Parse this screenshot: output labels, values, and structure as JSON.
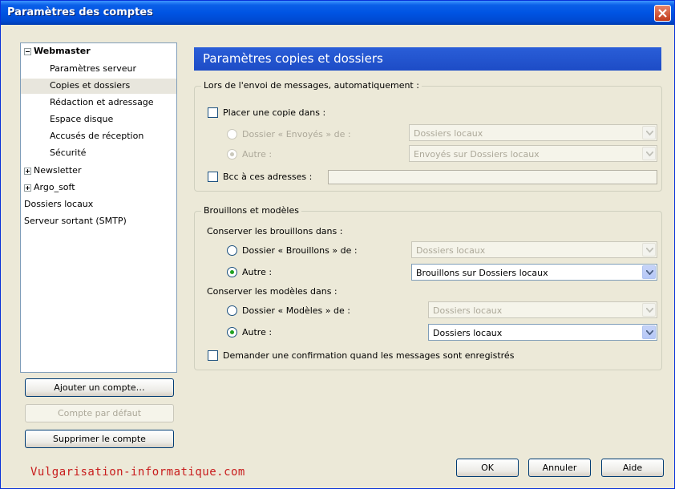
{
  "window": {
    "title": "Paramètres des comptes"
  },
  "tree": {
    "items": [
      {
        "label": "Webmaster",
        "bold": true,
        "expander": "minus"
      },
      {
        "label": "Paramètres serveur"
      },
      {
        "label": "Copies et dossiers",
        "selected": true
      },
      {
        "label": "Rédaction et adressage"
      },
      {
        "label": "Espace disque"
      },
      {
        "label": "Accusés de réception"
      },
      {
        "label": "Sécurité"
      },
      {
        "label": "Newsletter",
        "expander": "plus"
      },
      {
        "label": "Argo_soft",
        "expander": "plus"
      },
      {
        "label": "Dossiers locaux"
      },
      {
        "label": "Serveur sortant (SMTP)"
      }
    ]
  },
  "left_buttons": {
    "add_account": "Ajouter un compte…",
    "default_account": "Compte par défaut",
    "delete_account": "Supprimer le compte"
  },
  "panel": {
    "title": "Paramètres copies et dossiers",
    "sending": {
      "group_title": "Lors de l'envoi de messages, automatiquement :",
      "place_copy_label": "Placer une copie dans :",
      "sent_folder_radio": "Dossier « Envoyés » de :",
      "sent_folder_select": "Dossiers locaux",
      "other_radio": "Autre :",
      "other_select": "Envoyés sur Dossiers locaux",
      "bcc_label": "Bcc à ces adresses :",
      "bcc_value": ""
    },
    "drafts": {
      "group_title": "Brouillons et modèles",
      "keep_drafts_label": "Conserver les brouillons dans :",
      "drafts_folder_radio": "Dossier « Brouillons » de :",
      "drafts_folder_select": "Dossiers locaux",
      "drafts_other_radio": "Autre :",
      "drafts_other_select": "Brouillons sur Dossiers locaux",
      "keep_templates_label": "Conserver les modèles dans :",
      "templates_folder_radio": "Dossier « Modèles » de :",
      "templates_folder_select": "Dossiers locaux",
      "templates_other_radio": "Autre :",
      "templates_other_select": "Dossiers locaux",
      "confirm_label": "Demander une confirmation quand les messages sont enregistrés"
    }
  },
  "footer": {
    "ok": "OK",
    "cancel": "Annuler",
    "help": "Aide",
    "watermark": "Vulgarisation-informatique.com"
  }
}
